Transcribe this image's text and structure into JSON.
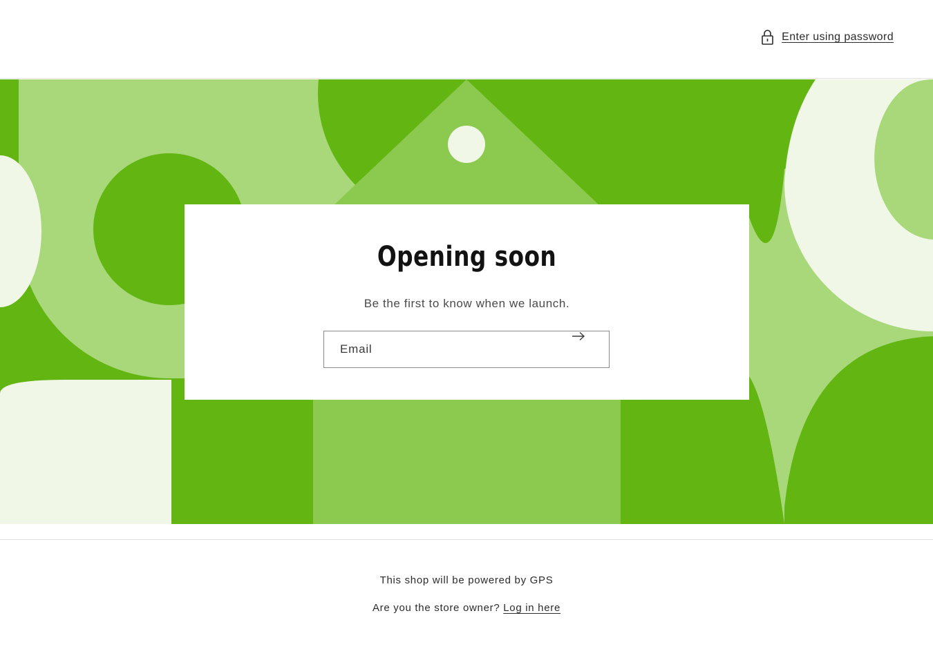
{
  "header": {
    "password_link_label": "Enter using password",
    "lock_icon": "lock-icon"
  },
  "hero": {
    "colors": {
      "dark_green": "#63b512",
      "mid_green": "#8bc94f",
      "light_green": "#a8d87a",
      "pale": "#f0f7e7"
    }
  },
  "card": {
    "title": "Opening soon",
    "subtitle": "Be the first to know when we launch.",
    "email_placeholder": "Email",
    "submit_icon": "arrow-right-icon"
  },
  "footer": {
    "powered_text": "This shop will be powered by GPS",
    "owner_prompt": "Are you the store owner?",
    "login_link": "Log in here"
  }
}
